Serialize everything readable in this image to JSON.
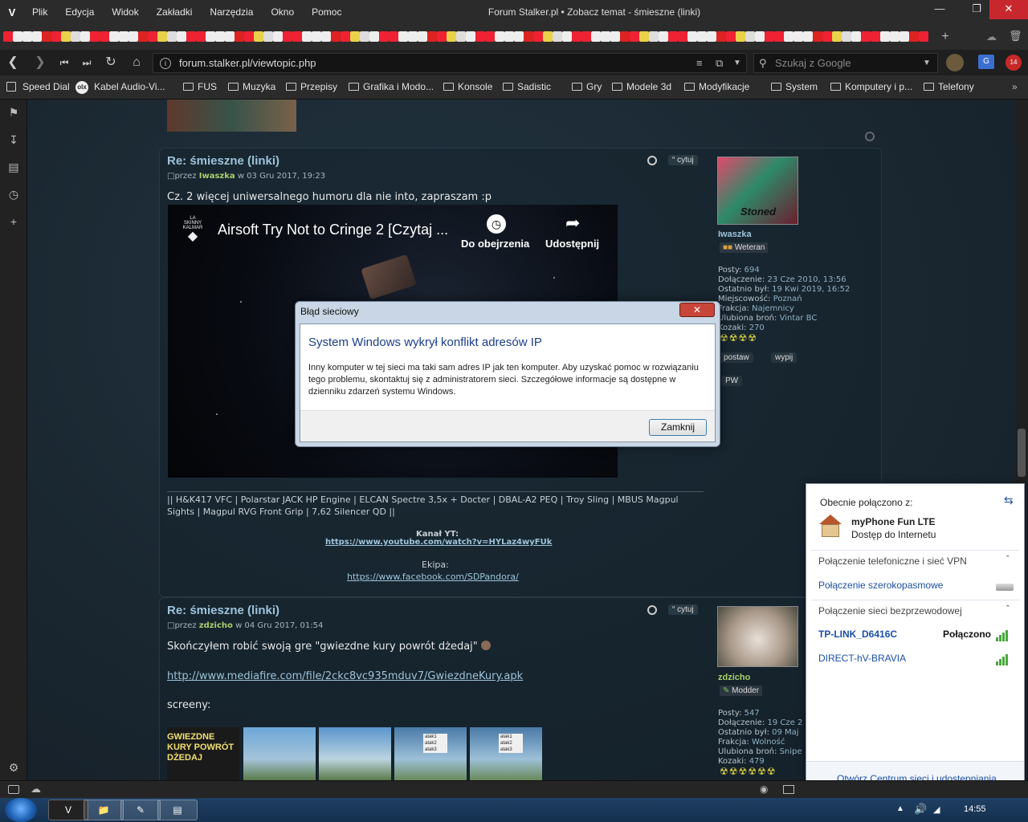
{
  "menubar": {
    "logo": "V",
    "items": [
      "Plik",
      "Edycja",
      "Widok",
      "Zakładki",
      "Narzędzia",
      "Okno",
      "Pomoc"
    ],
    "window_title": "Forum Stalker.pl • Zobacz temat - śmieszne (linki)"
  },
  "navbar": {
    "url": "forum.stalker.pl/viewtopic.php",
    "search_placeholder": "Szukaj z Google",
    "badge": "14"
  },
  "bookmarks": {
    "items": [
      "Speed Dial",
      "Kabel Audio-Vi...",
      "FUS",
      "Muzyka",
      "Przepisy",
      "Grafika i Modo...",
      "Konsole",
      "Sadistic",
      "Gry",
      "Modele 3d",
      "Modyfikacje",
      "System",
      "Komputery i p...",
      "Telefony"
    ]
  },
  "post1": {
    "title": "Re: śmieszne (linki)",
    "meta_prefix": "przez",
    "author": "Iwaszka",
    "meta_date": "w 03 Gru 2017, 19:23",
    "quote_label": "cytuj",
    "body": "Cz. 2 więcej uniwersalnego humoru dla nie into, zapraszam :p",
    "video_title": "Airsoft Try Not to Cringe 2 [Czytaj ...",
    "video_watch_later": "Do obejrzenia",
    "video_share": "Udostępnij",
    "signature_line": "|| H&K417 VFC | Polarstar JACK HP Engine | ELCAN Spectre 3,5x + Docter | DBAL-A2 PEQ | Troy Sling | MBUS Magpul Sights | Magpul RVG Front Grip | 7,62 Silencer QD ||",
    "channel_label": "Kanał YT:",
    "channel_url": "https://www.youtube.com/watch?v=HYLaz4wyFUk",
    "team_label": "Ekipa:",
    "team_url": "https://www.facebook.com/SDPandora/"
  },
  "profile1": {
    "avatar_caption": "Stoned",
    "name": "Iwaszka",
    "rank": "Weteran",
    "rows": [
      {
        "k": "Posty:",
        "v": "694"
      },
      {
        "k": "Dołączenie:",
        "v": "23 Cze 2010, 13:56"
      },
      {
        "k": "Ostatnio był:",
        "v": "19 Kwi 2019, 16:52"
      },
      {
        "k": "Miejscowość:",
        "v": "Poznań"
      },
      {
        "k": "Frakcja:",
        "v": "Najemnicy"
      },
      {
        "k": "Ulubiona broń:",
        "v": "Vintar BC"
      },
      {
        "k": "Kozaki:",
        "v": "270"
      }
    ],
    "btn_post": "postaw",
    "btn_drink": "wypij",
    "btn_pw": "PW"
  },
  "post2": {
    "title": "Re: śmieszne (linki)",
    "meta_prefix": "przez",
    "author": "zdzicho",
    "meta_date": "w 04 Gru 2017, 01:54",
    "quote_label": "cytuj",
    "body": "Skończyłem robić swoją gre \"gwiezdne kury powrót dżedaj\"",
    "link": "http://www.mediafire.com/file/2ckc8vc935mduv7/GwiezdneKury.apk",
    "screens_label": "screeny:",
    "thumb1_text": "GWIEZDNE KURY POWRÓT DŻEDAJ",
    "thumb_attack": [
      "atak1",
      "atak2",
      "atak3"
    ]
  },
  "profile2": {
    "name": "zdzicho",
    "rank": "Modder",
    "rows": [
      {
        "k": "Posty:",
        "v": "547"
      },
      {
        "k": "Dołączenie:",
        "v": "19 Cze 2"
      },
      {
        "k": "Ostatnio był:",
        "v": "09 Maj"
      },
      {
        "k": "Frakcja:",
        "v": "Wolność"
      },
      {
        "k": "Ulubiona broń:",
        "v": "Snipe"
      },
      {
        "k": "Kozaki:",
        "v": "479"
      }
    ]
  },
  "dialog": {
    "title": "Błąd sieciowy",
    "heading": "System Windows wykrył konflikt adresów IP",
    "text": "Inny komputer w tej sieci ma taki sam adres IP jak ten komputer. Aby uzyskać pomoc w rozwiązaniu tego problemu, skontaktuj się z administratorem sieci. Szczegółowe informacje są dostępne w dzienniku zdarzeń systemu Windows.",
    "close_label": "Zamknij"
  },
  "network": {
    "connected_to": "Obecnie połączono z:",
    "network_name": "myPhone Fun LTE",
    "network_status": "Dostęp do Internetu",
    "dialup_header": "Połączenie telefoniczne i sieć VPN",
    "broadband": "Połączenie szerokopasmowe",
    "wireless_header": "Połączenie sieci bezprzewodowej",
    "wifi": [
      {
        "name": "TP-LINK_D6416C",
        "status": "Połączono"
      },
      {
        "name": "DIRECT-hV-BRAVIA",
        "status": ""
      }
    ],
    "footer_link": "Otwórz Centrum sieci i udostępniania"
  },
  "taskbar": {
    "clock": "14:55"
  },
  "colors": {
    "accent": "#9ec3da",
    "username_green": "#a9d06a",
    "dialog_heading": "#1a3e8c",
    "close_red": "#c8282d"
  }
}
